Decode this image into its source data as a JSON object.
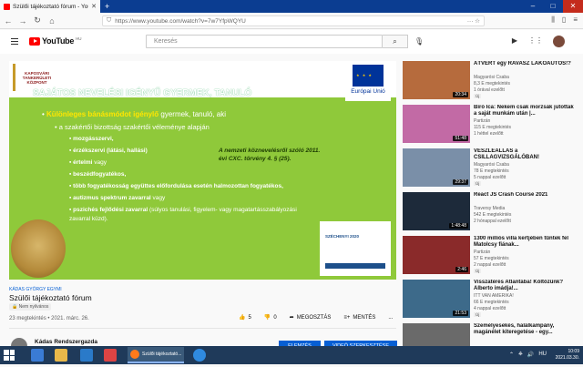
{
  "browser": {
    "tab_title": "Szülői tájékoztató fórum - YouTube",
    "url": "https://www.youtube.com/watch?v=7w7YfpWQYU"
  },
  "youtube": {
    "logo_text": "YouTube",
    "logo_cc": "HU",
    "search_placeholder": "Keresés"
  },
  "slide": {
    "logo_text": "KAPOSVÁRI TANKERÜLETI KÖZPONT",
    "eu_label": "Európai Unió",
    "title": "SAJÁTOS NEVELÉSI IGÉNYŰ GYERMEK, TANULÓ",
    "lead_bold": "Különleges bánásmódot igénylő",
    "lead_rest": " gyermek, tanuló, aki",
    "sub_intro": "a szakértői bizottság szakértői véleménye alapján",
    "bullets": [
      {
        "bold": "mozgásszervi,",
        "rest": ""
      },
      {
        "bold": "érzékszervi (látási, hallási)",
        "rest": ""
      },
      {
        "bold": "értelmi",
        "rest": " vagy"
      },
      {
        "bold": "beszédfogyatékos,",
        "rest": ""
      },
      {
        "bold": "több fogyatékosság együttes előfordulása esetén halmozottan fogyatékos,",
        "rest": ""
      },
      {
        "bold": "autizmus spektrum zavarral",
        "rest": " vagy"
      },
      {
        "bold": "pszichés fejlődési zavarral",
        "rest": " (súlyos tanulási, figyelem- vagy magatartásszabályozási zavarral küzd)."
      }
    ],
    "law_ref": "A nemzeti köznevelésről szóló 2011. évi CXC. törvény 4. § (25).",
    "szechenyi": "SZÉCHENYI 2020",
    "hashtag": "KÁDAS GYÖRGY EGYMI"
  },
  "video": {
    "title": "Szülői tájékoztató fórum",
    "listing": "Nem nyilvános",
    "stats": "23 megtekintés • 2021. márc. 26.",
    "likes": "5",
    "dislikes": "0",
    "share_label": "MEGOSZTÁS",
    "save_label": "MENTÉS",
    "more_label": "...",
    "channel": "Kádas Rendszergazda",
    "edit_label": "ELEMZÉS",
    "studio_label": "VIDEÓ SZERKESZTÉSE"
  },
  "recs": [
    {
      "title": "ÁTVERT egy RAVASZ LAKÓAUTÓS!?",
      "channel": "Magyarósi Csaba",
      "views": "8,3 E megtekintés",
      "time": "1 órával ezelőtt",
      "badge": "Új",
      "dur": "20:34",
      "color": "#b66b3d"
    },
    {
      "title": "Bíró Ica: Nekem csak morzsák jutottak a saját munkám után |...",
      "channel": "Partizán",
      "views": "115 E megtekintés",
      "time": "1 héttel ezelőtt",
      "badge": "",
      "dur": "51:48",
      "color": "#c26aa5"
    },
    {
      "title": "VÉSZLEÁLLÁS a CSILLAGVIZSGÁLÓBAN!",
      "channel": "Magyarósi Csaba",
      "views": "78 E megtekintés",
      "time": "5 nappal ezelőtt",
      "badge": "Új",
      "dur": "29:37",
      "color": "#7a8fa8"
    },
    {
      "title": "React JS Crash Course 2021",
      "channel": "Traversy Media",
      "views": "542 E megtekintés",
      "time": "2 hónappal ezelőtt",
      "badge": "",
      "dur": "1:48:48",
      "color": "#1d2a3a"
    },
    {
      "title": "1300 milliós villa kertjében tűntek fel Matolcsy fiának...",
      "channel": "Partizán",
      "views": "57 E megtekintés",
      "time": "2 nappal ezelőtt",
      "badge": "Új",
      "dur": "2:46",
      "color": "#8a2a2a"
    },
    {
      "title": "Visszatérés Atlantába! Költözünk? Alberto imádja!...",
      "channel": "ITT VAN AMERIKA!",
      "views": "66 E megtekintés",
      "time": "4 nappal ezelőtt",
      "badge": "Új",
      "dur": "21:53",
      "color": "#3d6a8a"
    },
    {
      "title": "Személyesekés, halálkampány, magánélet kiteregetése - egy...",
      "channel": "",
      "views": "",
      "time": "",
      "badge": "",
      "dur": "",
      "color": "#6a6a6a"
    }
  ],
  "taskbar": {
    "active_title": "Szülői tájékoztató...",
    "time": "10:09",
    "date": "2021.03.30.",
    "lang": "HU"
  }
}
